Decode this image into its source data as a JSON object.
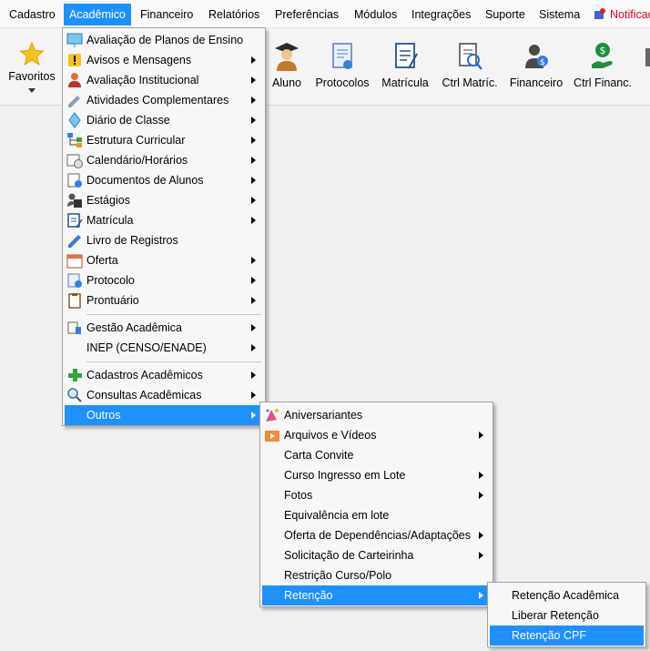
{
  "menubar": {
    "items": [
      "Cadastro",
      "Acadêmico",
      "Financeiro",
      "Relatórios",
      "Preferências",
      "Módulos",
      "Integrações",
      "Suporte",
      "Sistema"
    ],
    "notifications": "Notificações"
  },
  "toolbar": {
    "favoritos": "Favoritos",
    "aluno": "Aluno",
    "protocolos": "Protocolos",
    "matricula": "Matrícula",
    "ctrl_matric": "Ctrl Matríc.",
    "financeiro": "Financeiro",
    "ctrl_financ": "Ctrl Financ."
  },
  "academico_menu": {
    "items": [
      "Avaliação de Planos de Ensino",
      "Avisos e Mensagens",
      "Avaliação Institucional",
      "Atividades Complementares",
      "Diário de Classe",
      "Estrutura Curricular",
      "Calendário/Horários",
      "Documentos de Alunos",
      "Estágios",
      "Matrícula",
      "Livro de Registros",
      "Oferta",
      "Protocolo",
      "Prontuário",
      "Gestão Acadêmica",
      "INEP (CENSO/ENADE)",
      "Cadastros Acadêmicos",
      "Consultas Acadêmicas",
      "Outros"
    ]
  },
  "outros_menu": {
    "items": [
      "Aniversariantes",
      "Arquivos e Vídeos",
      "Carta Convite",
      "Curso Ingresso em Lote",
      "Fotos",
      "Equivalência em lote",
      "Oferta de Dependências/Adaptações",
      "Solicitação de Carteirinha",
      "Restrição Curso/Polo",
      "Retenção"
    ]
  },
  "retencao_menu": {
    "items": [
      "Retenção Acadêmica",
      "Liberar Retenção",
      "Retenção CPF"
    ]
  },
  "colors": {
    "highlight": "#1e90ff",
    "notification": "#d6002a"
  }
}
